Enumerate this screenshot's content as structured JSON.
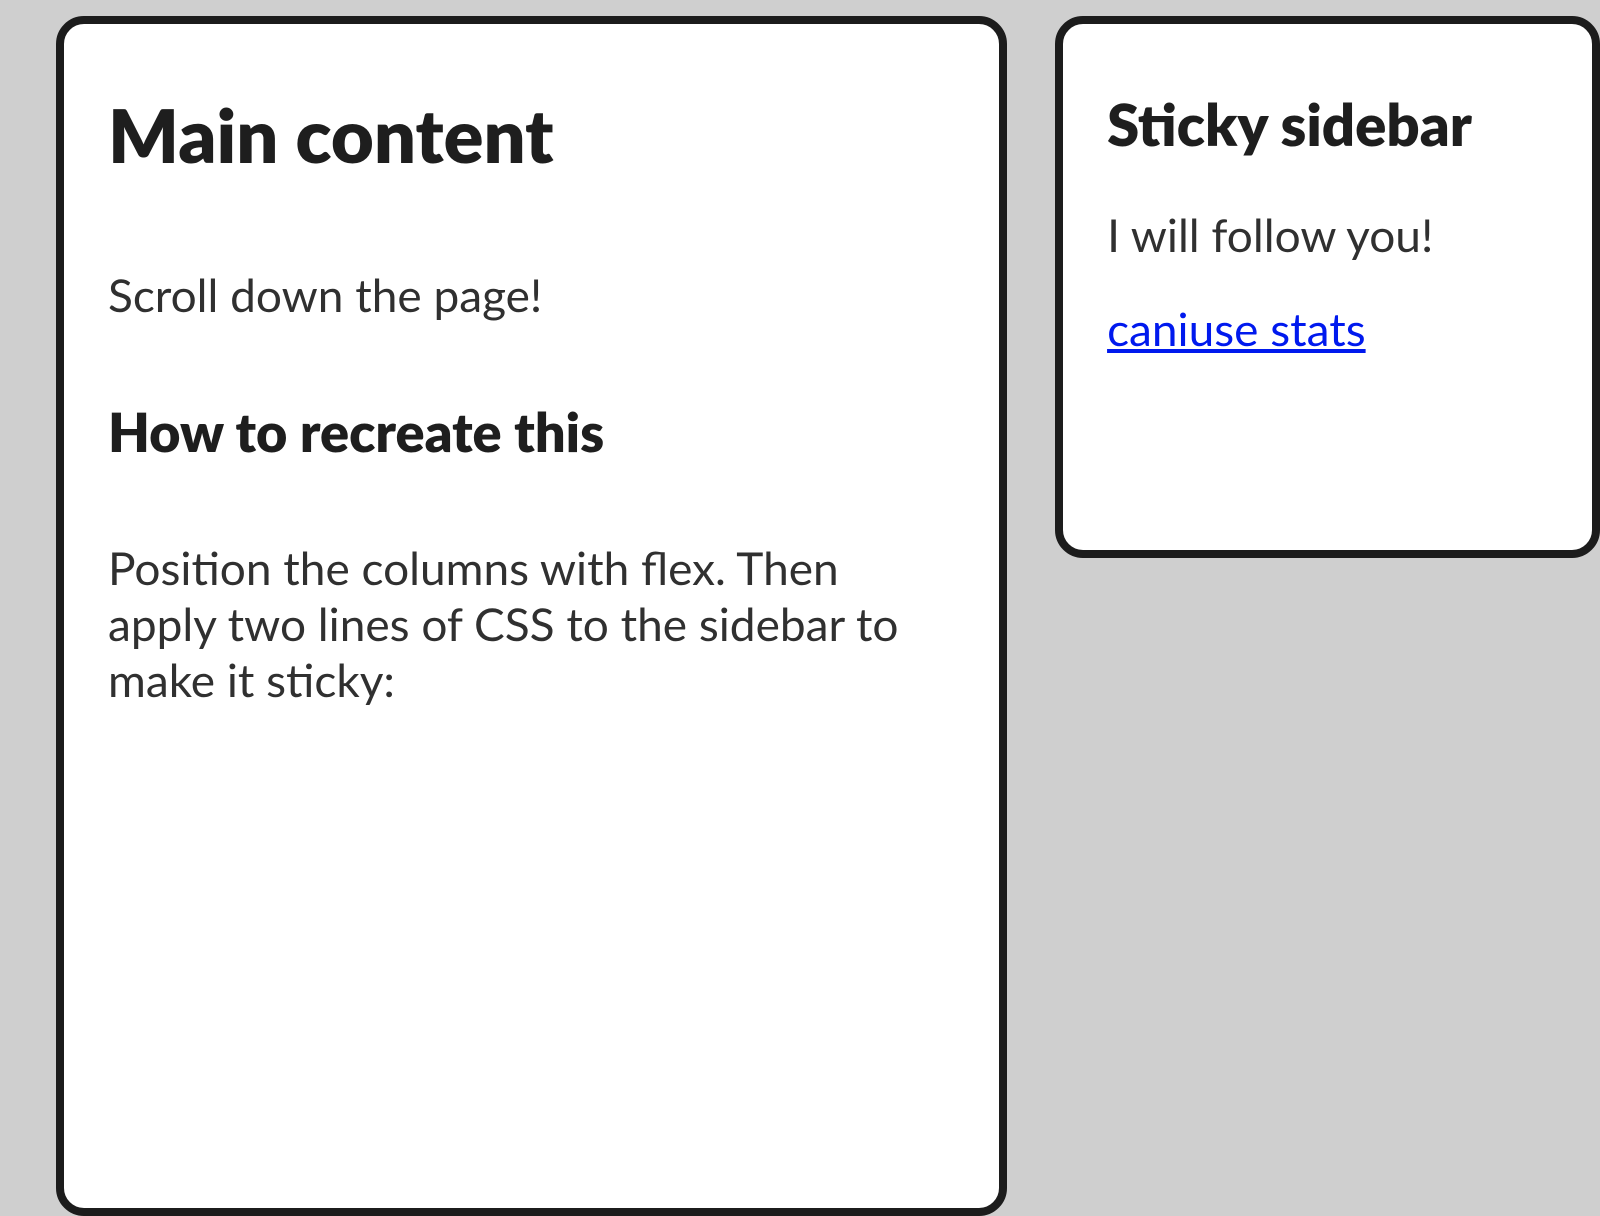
{
  "main": {
    "heading": "Main content",
    "intro": "Scroll down the page!",
    "sub_heading": "How to recreate this",
    "body_1": "Position the columns with flex. Then apply two lines of CSS to the sidebar to make it sticky:"
  },
  "sidebar": {
    "heading": "Sticky sidebar",
    "text": "I will follow you!",
    "link_label": "caniuse stats"
  }
}
